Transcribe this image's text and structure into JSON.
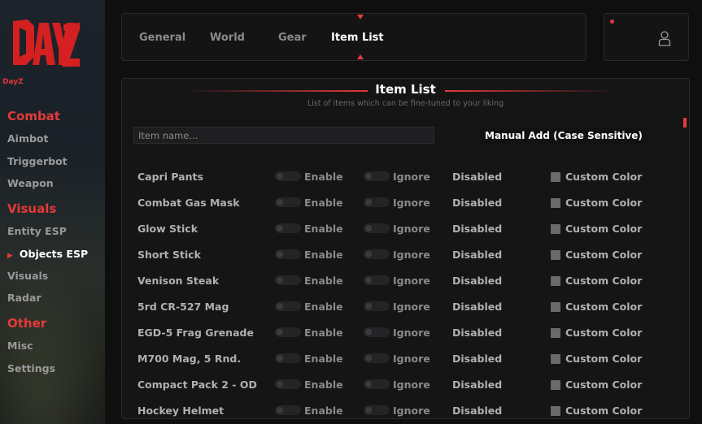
{
  "brand": {
    "name": "DayZ"
  },
  "sidebar": {
    "sections": [
      {
        "title": "Combat",
        "items": [
          "Aimbot",
          "Triggerbot",
          "Weapon"
        ]
      },
      {
        "title": "Visuals",
        "items": [
          "Entity ESP",
          "Objects ESP",
          "Visuals",
          "Radar"
        ]
      },
      {
        "title": "Other",
        "items": [
          "Misc",
          "Settings"
        ]
      }
    ],
    "active_item": "Objects ESP"
  },
  "tabs": {
    "general": "General",
    "world": "World",
    "gear": "Gear",
    "item_list": "Item List",
    "active": "Item List"
  },
  "panel": {
    "title": "Item List",
    "subtitle": "List of items which can be fine-tuned to your liking",
    "search_placeholder": "Item name...",
    "manual_add_label": "Manual Add (Case Sensitive)"
  },
  "items": [
    {
      "name": "Capri Pants",
      "enable": "Enable",
      "ignore": "Ignore",
      "status": "Disabled",
      "custom_color": "Custom Color"
    },
    {
      "name": "Combat Gas Mask",
      "enable": "Enable",
      "ignore": "Ignore",
      "status": "Disabled",
      "custom_color": "Custom Color"
    },
    {
      "name": "Glow Stick",
      "enable": "Enable",
      "ignore": "Ignore",
      "status": "Disabled",
      "custom_color": "Custom Color"
    },
    {
      "name": "Short Stick",
      "enable": "Enable",
      "ignore": "Ignore",
      "status": "Disabled",
      "custom_color": "Custom Color"
    },
    {
      "name": "Venison Steak",
      "enable": "Enable",
      "ignore": "Ignore",
      "status": "Disabled",
      "custom_color": "Custom Color"
    },
    {
      "name": "5rd CR-527 Mag",
      "enable": "Enable",
      "ignore": "Ignore",
      "status": "Disabled",
      "custom_color": "Custom Color"
    },
    {
      "name": "EGD-5 Frag Grenade",
      "enable": "Enable",
      "ignore": "Ignore",
      "status": "Disabled",
      "custom_color": "Custom Color"
    },
    {
      "name": "M700 Mag, 5 Rnd.",
      "enable": "Enable",
      "ignore": "Ignore",
      "status": "Disabled",
      "custom_color": "Custom Color"
    },
    {
      "name": "Compact Pack 2 - OD",
      "enable": "Enable",
      "ignore": "Ignore",
      "status": "Disabled",
      "custom_color": "Custom Color"
    },
    {
      "name": "Hockey Helmet",
      "enable": "Enable",
      "ignore": "Ignore",
      "status": "Disabled",
      "custom_color": "Custom Color"
    }
  ],
  "colors": {
    "accent": "#e43a3a",
    "background": "#0f0f10",
    "panel": "#151516"
  },
  "icons": {
    "user": "user-icon",
    "logo": "dayz-logo"
  }
}
